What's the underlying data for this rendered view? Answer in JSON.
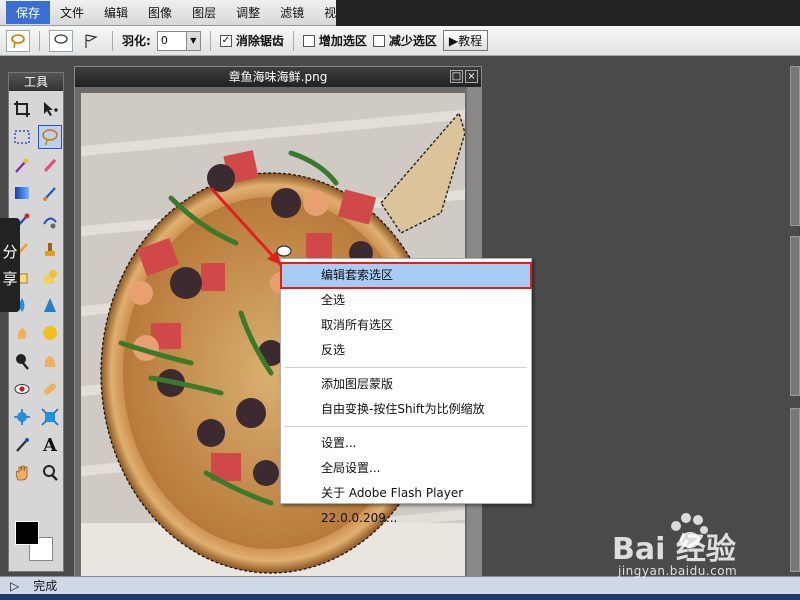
{
  "menu": {
    "items": [
      "保存",
      "文件",
      "编辑",
      "图像",
      "图层",
      "调整",
      "滤镜",
      "视图"
    ]
  },
  "toolbar": {
    "feather_label": "羽化:",
    "feather_value": "0",
    "antialias_label": "消除锯齿",
    "antialias_checked": true,
    "add_selection_label": "增加选区",
    "subtract_selection_label": "减少选区",
    "tutorial_label": "▶教程"
  },
  "tools_panel": {
    "title": "工具"
  },
  "share_tab": {
    "label_top": "分",
    "label_bottom": "享"
  },
  "document": {
    "title": "章鱼海味海鲜.png"
  },
  "context_menu": {
    "items": [
      {
        "label": "编辑套索选区",
        "highlighted": true
      },
      {
        "label": "全选"
      },
      {
        "label": "取消所有选区"
      },
      {
        "label": "反选"
      },
      {
        "label": "添加图层蒙版"
      },
      {
        "label": "自由变换-按住Shift为比例缩放"
      },
      {
        "label": "设置..."
      },
      {
        "label": "全局设置..."
      },
      {
        "label": "关于 Adobe Flash Player 22.0.0.209..."
      }
    ]
  },
  "status": {
    "text": "完成"
  },
  "watermark": {
    "brand": "Bai 经验",
    "url": "jingyan.baidu.com"
  },
  "colors": {
    "highlight_red": "#e02020",
    "menu_highlight": "#a8cdf5"
  }
}
